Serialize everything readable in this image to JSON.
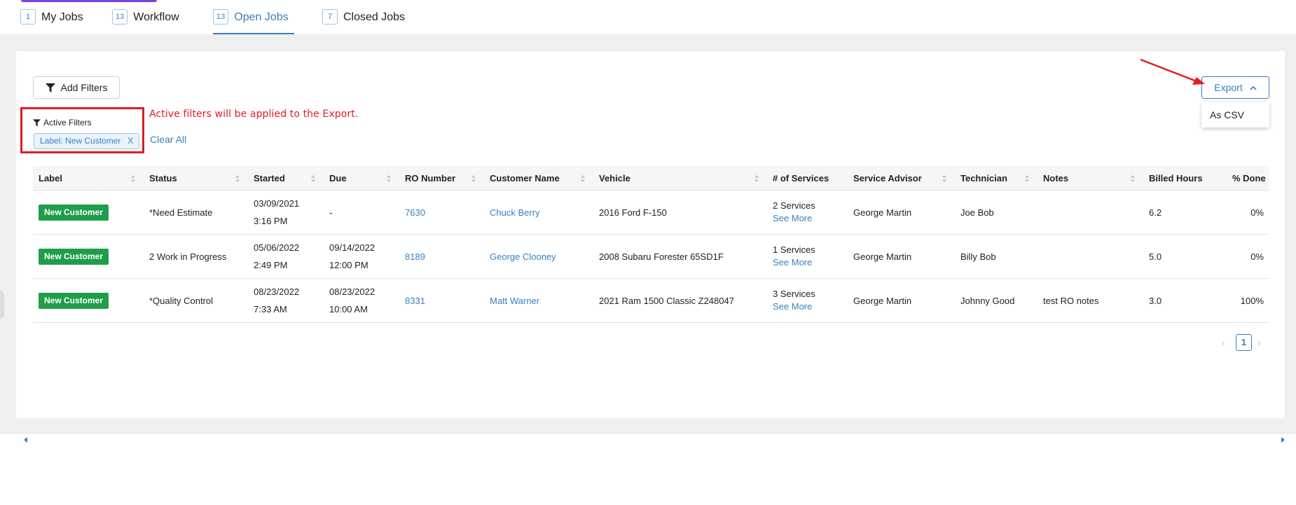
{
  "tabs": [
    {
      "count": "1",
      "label": "My Jobs",
      "active": false
    },
    {
      "count": "13",
      "label": "Workflow",
      "active": false
    },
    {
      "count": "13",
      "label": "Open Jobs",
      "active": true
    },
    {
      "count": "7",
      "label": "Closed Jobs",
      "active": false
    }
  ],
  "toolbar": {
    "add_filters_label": "Add Filters",
    "export_label": "Export",
    "export_options": [
      "As CSV"
    ]
  },
  "filters": {
    "title": "Active Filters",
    "chips": [
      {
        "label": "Label: New Customer",
        "remove": "X"
      }
    ],
    "clear_all_label": "Clear All"
  },
  "annotation": {
    "text": "Active filters will be applied to the Export.",
    "color": "#e31b23"
  },
  "table": {
    "columns": [
      "Label",
      "Status",
      "Started",
      "Due",
      "RO Number",
      "Customer Name",
      "Vehicle",
      "# of Services",
      "Service Advisor",
      "Technician",
      "Notes",
      "Billed Hours",
      "% Done"
    ],
    "rows": [
      {
        "label": "New Customer",
        "status": "*Need Estimate",
        "started_date": "03/09/2021",
        "started_time": "3:16 PM",
        "due_date": "-",
        "due_time": "",
        "ro_number": "7630",
        "customer": "Chuck Berry",
        "vehicle": "2016 Ford F-150",
        "services": "2 Services",
        "see_more": "See More",
        "advisor": "George Martin",
        "technician": "Joe Bob",
        "notes": "",
        "billed_hours": "6.2",
        "percent_done": "0%"
      },
      {
        "label": "New Customer",
        "status": "2 Work in Progress",
        "started_date": "05/06/2022",
        "started_time": "2:49 PM",
        "due_date": "09/14/2022",
        "due_time": "12:00 PM",
        "ro_number": "8189",
        "customer": "George Clooney",
        "vehicle": "2008 Subaru Forester 65SD1F",
        "services": "1 Services",
        "see_more": "See More",
        "advisor": "George Martin",
        "technician": "Billy Bob",
        "notes": "",
        "billed_hours": "5.0",
        "percent_done": "0%"
      },
      {
        "label": "New Customer",
        "status": "*Quality Control",
        "started_date": "08/23/2022",
        "started_time": "7:33 AM",
        "due_date": "08/23/2022",
        "due_time": "10:00 AM",
        "ro_number": "8331",
        "customer": "Matt Warner",
        "vehicle": "2021 Ram 1500 Classic Z248047",
        "services": "3 Services",
        "see_more": "See More",
        "advisor": "George Martin",
        "technician": "Johnny Good",
        "notes": "test RO notes",
        "billed_hours": "3.0",
        "percent_done": "100%"
      }
    ]
  },
  "pagination": {
    "current_page": "1",
    "prev": "‹",
    "next": "›"
  },
  "colors": {
    "accent": "#3a7fc1",
    "badge_green": "#1e9e4a",
    "annotation_red": "#e31b23",
    "brand_purple": "#7b3fe4"
  }
}
